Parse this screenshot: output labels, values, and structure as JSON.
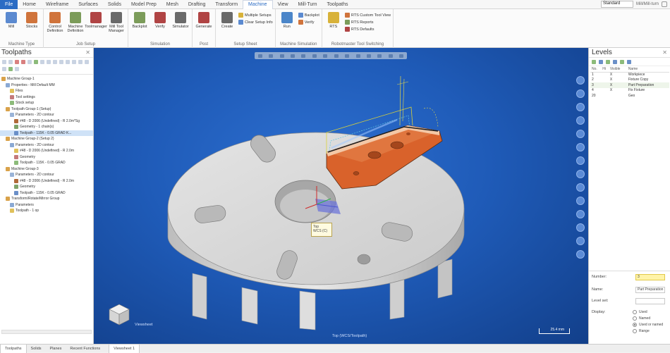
{
  "menu": {
    "file": "File",
    "tabs": [
      "Home",
      "Wireframe",
      "Surfaces",
      "Solids",
      "Model Prep",
      "Mesh",
      "Drafting",
      "Transform",
      "Machine",
      "View",
      "Mill-Turn",
      "Toolpaths"
    ],
    "active_tab": "Machine",
    "planes_value": "Standard",
    "right_label": "Mill/Mill-turn"
  },
  "ribbon": {
    "groups": [
      {
        "name": "Machine Type",
        "buttons": [
          "Mill",
          "Stocks"
        ]
      },
      {
        "name": "Job Setup",
        "buttons": [
          "Control Definition",
          "Machine Definition",
          "Toolmanager",
          "Mill Tool Manager"
        ]
      },
      {
        "name": "Simulation",
        "buttons": [
          "Backplot",
          "Verify",
          "Simulator"
        ]
      },
      {
        "name": "Post",
        "buttons": [
          "Generate"
        ]
      },
      {
        "name": "Setup Sheet",
        "buttons": [
          "Create"
        ],
        "small": [
          "Multiple Setups",
          "Clear Setup Info"
        ]
      },
      {
        "name": "Machine Simulation",
        "buttons": [
          "Run"
        ],
        "small": [
          "Backplot",
          "Verify"
        ]
      },
      {
        "name": "Robotmaster Tool Switching",
        "buttons": [
          "RTS"
        ],
        "small": [
          "RTS Custom Tool View",
          "RTS Reports",
          "RTS Defaults"
        ]
      }
    ]
  },
  "left_panel": {
    "title": "Toolpaths",
    "tree": [
      "Machine Group-1",
      "Properties - Mill Default MM",
      "Files",
      "Tool settings",
      "Stock setup",
      "Toolpath Group-1 (Setup)",
      "Parameters - 2D contour",
      "#48 - D 2006 (Undefined) - R 2.0m*Sg",
      "Geometry - 1 chain(s)",
      "Toolpath - 115K - 0.05 GRAD K...",
      "Machine Group-2 (Setup 2)",
      "Parameters - 2D contour",
      "#48 - D 2006 (Undefined) - R 2.0m",
      "Geometry",
      "Toolpath - 115K - 0.05 GRAD",
      "Machine Group-3",
      "Parameters - 2D contour",
      "#48 - D 2006 (Undefined) - R 2.0m",
      "Geometry",
      "Toolpath - 115K - 0.05 GRAD",
      "Transform/Rotate/Mirror Group",
      "Parameters",
      "Toolpath - 1 op"
    ],
    "bottom_tabs": [
      "Toolpaths",
      "Solids",
      "Planes",
      "Recent Functions"
    ]
  },
  "viewport": {
    "bottom_left_text": "Viewsheet",
    "bottom_center_text": "Top (WCS/Toolpath)",
    "scale_text": "25.4 mm",
    "callout": [
      "Top",
      "WCS (C)"
    ],
    "tab": "Viewsheet 1"
  },
  "right_panel": {
    "title": "Levels",
    "columns": [
      "No.",
      "Hi",
      "Visible",
      "Name"
    ],
    "rows": [
      {
        "no": "1",
        "hi": "",
        "visible": "X",
        "name": "Workpiece"
      },
      {
        "no": "2",
        "hi": "",
        "visible": "X",
        "name": "Fixture Copy"
      },
      {
        "no": "3",
        "hi": "",
        "visible": "X",
        "name": "Part Preparation"
      },
      {
        "no": "4",
        "hi": "",
        "visible": "X",
        "name": "Fix Fixture"
      },
      {
        "no": "20",
        "hi": "",
        "visible": "",
        "name": "Geo"
      }
    ],
    "current_row": 2,
    "props": {
      "number_label": "Number:",
      "number_value": "3",
      "name_label": "Name:",
      "name_value": "Part Preparation",
      "level_set_label": "Level set:",
      "level_set_value": "",
      "display_label": "Display:",
      "display_options": [
        "Used",
        "Named",
        "Used or named",
        "Range"
      ],
      "display_selected": "Used or named"
    }
  },
  "colors": {
    "viewport_blue": "#1f5bb8",
    "part_orange": "#d9622b",
    "fixture_gray": "#d9d9d9",
    "file_blue": "#2b6cc4"
  }
}
